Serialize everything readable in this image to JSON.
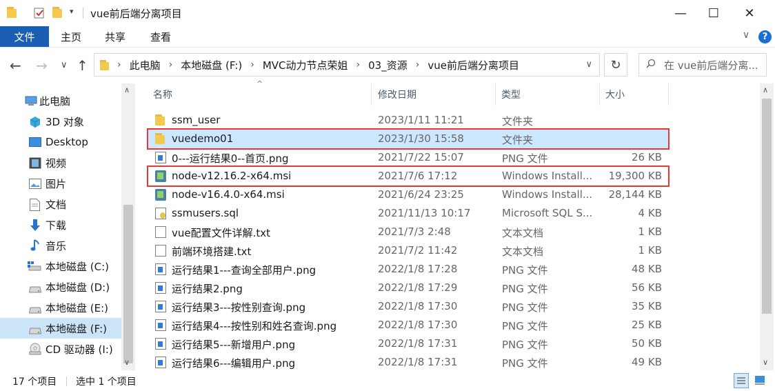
{
  "window": {
    "title": "vue前后端分离项目",
    "minimize": "—",
    "maximize": "☐",
    "close": "✕"
  },
  "ribbon": {
    "tabs": [
      "文件",
      "主页",
      "共享",
      "查看"
    ],
    "help": "?",
    "chevron": "∨"
  },
  "address": {
    "back": "←",
    "forward": "→",
    "recent": "∨",
    "up": "↑",
    "crumbs": [
      "此电脑",
      "本地磁盘 (F:)",
      "MVC动力节点荣姐",
      "03_资源",
      "vue前后端分离项目"
    ],
    "dropdown": "∨",
    "refresh": "↻",
    "search_placeholder": "在 vue前后端分离..."
  },
  "nav": {
    "items": [
      {
        "label": "此电脑",
        "icon": "computer-icon"
      },
      {
        "label": "3D 对象",
        "icon": "3d-objects-icon"
      },
      {
        "label": "Desktop",
        "icon": "desktop-icon"
      },
      {
        "label": "视频",
        "icon": "video-icon"
      },
      {
        "label": "图片",
        "icon": "pictures-icon"
      },
      {
        "label": "文档",
        "icon": "documents-icon"
      },
      {
        "label": "下载",
        "icon": "download-icon"
      },
      {
        "label": "音乐",
        "icon": "music-icon"
      },
      {
        "label": "本地磁盘 (C:)",
        "icon": "system-drive-icon"
      },
      {
        "label": "本地磁盘 (D:)",
        "icon": "drive-icon"
      },
      {
        "label": "本地磁盘 (E:)",
        "icon": "drive-icon"
      },
      {
        "label": "本地磁盘 (F:)",
        "icon": "drive-icon",
        "selected": true
      },
      {
        "label": "CD 驱动器 (I:)",
        "icon": "cd-drive-icon"
      }
    ]
  },
  "list": {
    "columns": {
      "name": "名称",
      "date": "修改日期",
      "type": "类型",
      "size": "大小"
    },
    "sort_indicator": "^",
    "files": [
      {
        "name": "ssm_user",
        "date": "2023/1/11 11:21",
        "type": "文件夹",
        "size": "",
        "icon": "folder-icon"
      },
      {
        "name": "vuedemo01",
        "date": "2023/1/30 15:58",
        "type": "文件夹",
        "size": "",
        "icon": "folder-icon",
        "selected": true,
        "highlighted": true
      },
      {
        "name": "0---运行结果0--首页.png",
        "date": "2021/7/22 15:07",
        "type": "PNG 文件",
        "size": "26 KB",
        "icon": "png-file-icon"
      },
      {
        "name": "node-v12.16.2-x64.msi",
        "date": "2021/7/6 17:12",
        "type": "Windows Install...",
        "size": "19,300 KB",
        "icon": "msi-installer-icon",
        "highlighted": true
      },
      {
        "name": "node-v16.4.0-x64.msi",
        "date": "2021/6/24 23:25",
        "type": "Windows Install...",
        "size": "28,144 KB",
        "icon": "msi-installer-icon"
      },
      {
        "name": "ssmusers.sql",
        "date": "2021/11/13 10:17",
        "type": "Microsoft SQL S...",
        "size": "4 KB",
        "icon": "sql-file-icon"
      },
      {
        "name": "vue配置文件详解.txt",
        "date": "2021/7/3 2:48",
        "type": "文本文档",
        "size": "1 KB",
        "icon": "text-file-icon"
      },
      {
        "name": "前端环境搭建.txt",
        "date": "2021/7/2 11:42",
        "type": "文本文档",
        "size": "1 KB",
        "icon": "text-file-icon"
      },
      {
        "name": "运行结果1---查询全部用户.png",
        "date": "2022/1/8 17:28",
        "type": "PNG 文件",
        "size": "48 KB",
        "icon": "png-file-icon"
      },
      {
        "name": "运行结果2.png",
        "date": "2022/1/8 17:29",
        "type": "PNG 文件",
        "size": "56 KB",
        "icon": "png-file-icon"
      },
      {
        "name": "运行结果3---按性别查询.png",
        "date": "2022/1/8 17:30",
        "type": "PNG 文件",
        "size": "35 KB",
        "icon": "png-file-icon"
      },
      {
        "name": "运行结果4---按性别和姓名查询.png",
        "date": "2022/1/8 17:30",
        "type": "PNG 文件",
        "size": "25 KB",
        "icon": "png-file-icon"
      },
      {
        "name": "运行结果5---新增用户.png",
        "date": "2022/1/8 17:31",
        "type": "PNG 文件",
        "size": "50 KB",
        "icon": "png-file-icon"
      },
      {
        "name": "运行结果6---编辑用户.png",
        "date": "2022/1/8 17:31",
        "type": "PNG 文件",
        "size": "49 KB",
        "icon": "png-file-icon"
      }
    ]
  },
  "status": {
    "item_count": "17 个项目",
    "selection": "选中 1 个项目"
  },
  "colors": {
    "accent": "#1a5fb4",
    "selection": "#cce8ff",
    "highlight_box": "#e53935",
    "folder": "#f3c94e"
  }
}
